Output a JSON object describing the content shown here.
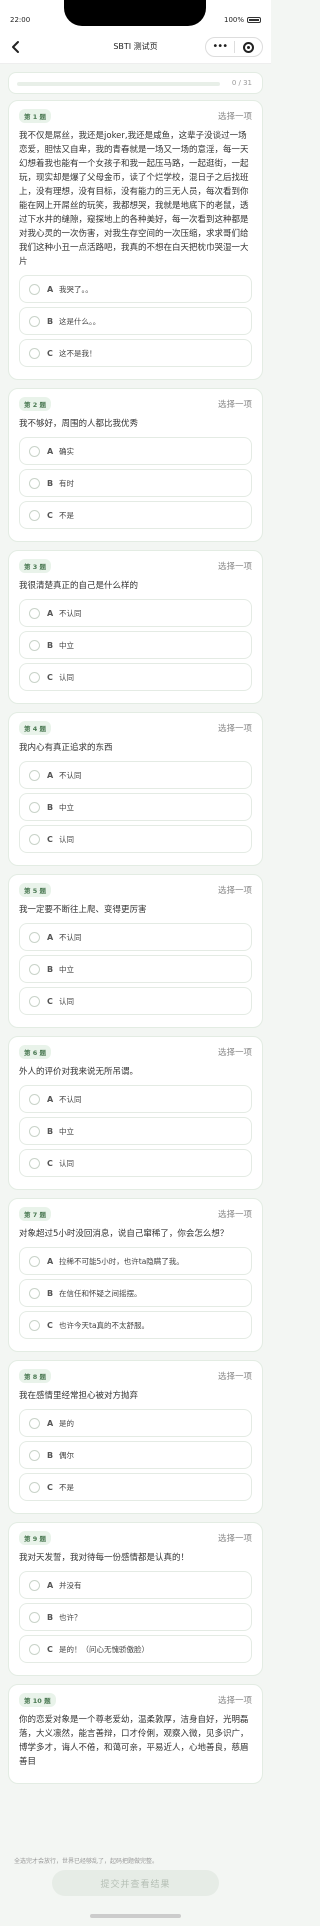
{
  "status": {
    "time": "22:00",
    "battery": "100%"
  },
  "nav": {
    "title": "SBTI 测试页"
  },
  "progress": {
    "text": "0 / 31",
    "value": 0
  },
  "questions": [
    {
      "num": "第 1 题",
      "hint": "选择一项",
      "text": "我不仅是屌丝，我还是joker,我还是咸鱼，这辈子没谈过一场恋爱，胆怯又自卑，我的青春就是一场又一场的意淫，每一天幻想着我也能有一个女孩子和我一起压马路，一起逛街，一起玩，现实却是爆了父母金币，读了个烂学校，混日子之后找班上，没有理想，没有目标，没有能力的三无人员，每次看到你能在网上开屌丝的玩笑，我都想哭，我就是地底下的老鼠，透过下水井的缝隙，窥探地上的各种美好，每一次看到这种都是对我心灵的一次伤害，对我生存空间的一次压缩，求求哥们给我们这种小丑一点活路吧，我真的不想在白天把枕巾哭湿一大片",
      "options": [
        {
          "letter": "A",
          "text": "我哭了。。"
        },
        {
          "letter": "B",
          "text": "这是什么。。"
        },
        {
          "letter": "C",
          "text": "这不是我！"
        }
      ]
    },
    {
      "num": "第 2 题",
      "hint": "选择一项",
      "text": "我不够好，周围的人都比我优秀",
      "options": [
        {
          "letter": "A",
          "text": "确实"
        },
        {
          "letter": "B",
          "text": "有时"
        },
        {
          "letter": "C",
          "text": "不是"
        }
      ]
    },
    {
      "num": "第 3 题",
      "hint": "选择一项",
      "text": "我很清楚真正的自己是什么样的",
      "options": [
        {
          "letter": "A",
          "text": "不认同"
        },
        {
          "letter": "B",
          "text": "中立"
        },
        {
          "letter": "C",
          "text": "认同"
        }
      ]
    },
    {
      "num": "第 4 题",
      "hint": "选择一项",
      "text": "我内心有真正追求的东西",
      "options": [
        {
          "letter": "A",
          "text": "不认同"
        },
        {
          "letter": "B",
          "text": "中立"
        },
        {
          "letter": "C",
          "text": "认同"
        }
      ]
    },
    {
      "num": "第 5 题",
      "hint": "选择一项",
      "text": "我一定要不断往上爬、变得更厉害",
      "options": [
        {
          "letter": "A",
          "text": "不认同"
        },
        {
          "letter": "B",
          "text": "中立"
        },
        {
          "letter": "C",
          "text": "认同"
        }
      ]
    },
    {
      "num": "第 6 题",
      "hint": "选择一项",
      "text": "外人的评价对我来说无所吊谓。",
      "options": [
        {
          "letter": "A",
          "text": "不认同"
        },
        {
          "letter": "B",
          "text": "中立"
        },
        {
          "letter": "C",
          "text": "认同"
        }
      ]
    },
    {
      "num": "第 7 题",
      "hint": "选择一项",
      "text": "对象超过5小时没回消息，说自己窜稀了，你会怎么想？",
      "options": [
        {
          "letter": "A",
          "text": "拉稀不可能5小时，也许ta隐瞒了我。"
        },
        {
          "letter": "B",
          "text": "在信任和怀疑之间摇摆。"
        },
        {
          "letter": "C",
          "text": "也许今天ta真的不太舒服。"
        }
      ]
    },
    {
      "num": "第 8 题",
      "hint": "选择一项",
      "text": "我在感情里经常担心被对方抛弃",
      "options": [
        {
          "letter": "A",
          "text": "是的"
        },
        {
          "letter": "B",
          "text": "偶尔"
        },
        {
          "letter": "C",
          "text": "不是"
        }
      ]
    },
    {
      "num": "第 9 题",
      "hint": "选择一项",
      "text": "我对天发誓，我对待每一份感情都是认真的！",
      "options": [
        {
          "letter": "A",
          "text": "并没有"
        },
        {
          "letter": "B",
          "text": "也许？"
        },
        {
          "letter": "C",
          "text": "是的！（问心无愧骄傲脸）"
        }
      ]
    },
    {
      "num": "第 10 题",
      "hint": "选择一项",
      "text": "你的恋爱对象是一个尊老爱幼，温柔敦厚，洁身自好，光明磊落，大义凛然，能言善辩，口才伶俐，观察入微，见多识广，博学多才，诲人不倦，和蔼可亲，平易近人，心地善良，慈眉善目",
      "options": []
    }
  ],
  "footer": {
    "hint": "全选完才会放行，世界已经够乱了，起码把题做完整。",
    "submit_label": "提交并查看结果"
  }
}
